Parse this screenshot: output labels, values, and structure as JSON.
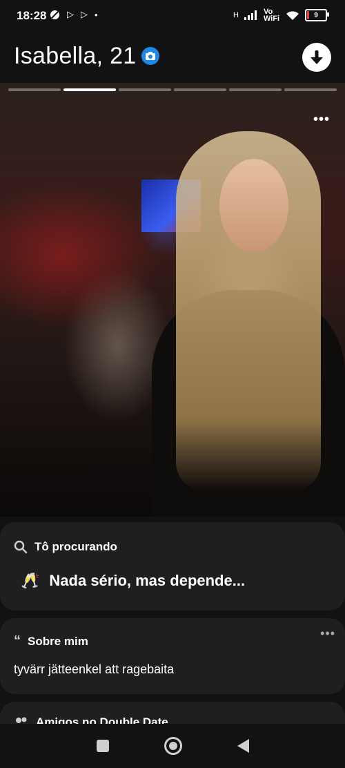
{
  "status": {
    "time": "18:28",
    "network_label": "Vo WiFi",
    "signal_prefix": "H",
    "battery": "9",
    "battery_level": 0.09
  },
  "profile": {
    "name_age": "Isabella, 21"
  },
  "photo": {
    "segments": 6,
    "active_segment": 2
  },
  "looking_for": {
    "heading": "Tô procurando",
    "emoji": "🥂",
    "value": "Nada sério, mas depende..."
  },
  "about": {
    "heading": "Sobre mim",
    "text": "tyvärr jätteenkel att ragebaita"
  },
  "friends": {
    "heading": "Amigos no Double Date"
  },
  "icons": {
    "verified": "camera-icon",
    "download": "arrow-down-icon",
    "search": "search-icon",
    "quote": "quote-icon"
  },
  "colors": {
    "background": "#111214",
    "card": "#1f1f22",
    "verified_blue": "#1e88e5"
  }
}
